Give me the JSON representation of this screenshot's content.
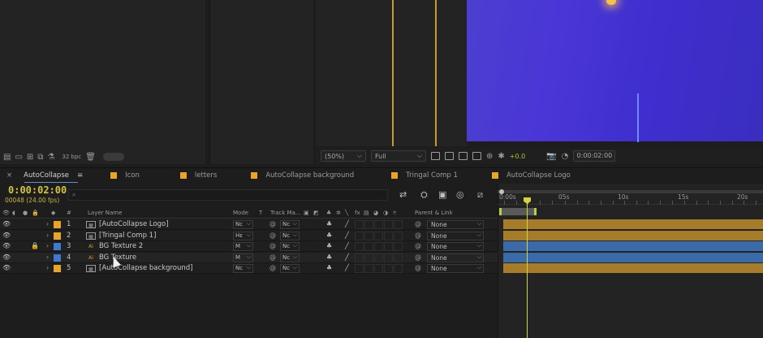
{
  "project_panel": {
    "bpc": "32 bpc"
  },
  "viewer": {
    "zoom": "(50%)",
    "resolution": "Full",
    "exposure": "+0.0",
    "time": "0:00:02:00"
  },
  "tabs": [
    {
      "label": "AutoCollapse",
      "active": true
    },
    {
      "label": "Icon"
    },
    {
      "label": "letters"
    },
    {
      "label": "AutoCollapse background"
    },
    {
      "label": "Tringal Comp 1"
    },
    {
      "label": "AutoCollapse Logo"
    }
  ],
  "timeline": {
    "timecode": "0:00:02:00",
    "fps": "00048 (24.00 fps)",
    "search_placeholder": "⌕",
    "columns": {
      "hash": "#",
      "layer_name": "Layer Name",
      "mode": "Mode",
      "t": "T",
      "track_matte": "Track Ma...",
      "parent_link": "Parent & Link"
    },
    "ruler": [
      "0:00s",
      "05s",
      "10s",
      "15s",
      "20s"
    ],
    "layers": [
      {
        "num": "1",
        "type": "comp",
        "name": "[AutoCollapse Logo]",
        "mode": "Nc",
        "matte": "Nc",
        "parent": "None",
        "label_color": "#e9a526",
        "bar": "gold",
        "locked": false
      },
      {
        "num": "2",
        "type": "comp",
        "name": "[Tringal Comp 1]",
        "mode": "Hε",
        "matte": "Nc",
        "parent": "None",
        "label_color": "#e9a526",
        "bar": "gold",
        "locked": false
      },
      {
        "num": "3",
        "type": "ai",
        "name": "BG Texture 2",
        "mode": "M",
        "matte": "Nc",
        "parent": "None",
        "label_color": "#3c7bd0",
        "bar": "blue",
        "locked": true
      },
      {
        "num": "4",
        "type": "ai",
        "name": "BG Texture",
        "mode": "M",
        "matte": "Nc",
        "parent": "None",
        "label_color": "#3c7bd0",
        "bar": "blue",
        "locked": false
      },
      {
        "num": "5",
        "type": "comp",
        "name": "[AutoCollapse background]",
        "mode": "Nc",
        "matte": "Nc",
        "parent": "None",
        "label_color": "#e9a526",
        "bar": "gold",
        "locked": false
      }
    ]
  },
  "colors": {
    "timecode": "#d3c63b",
    "playhead": "#d4d43a",
    "gold_bar": "#a57d2a",
    "blue_bar": "#3a6aa8"
  }
}
